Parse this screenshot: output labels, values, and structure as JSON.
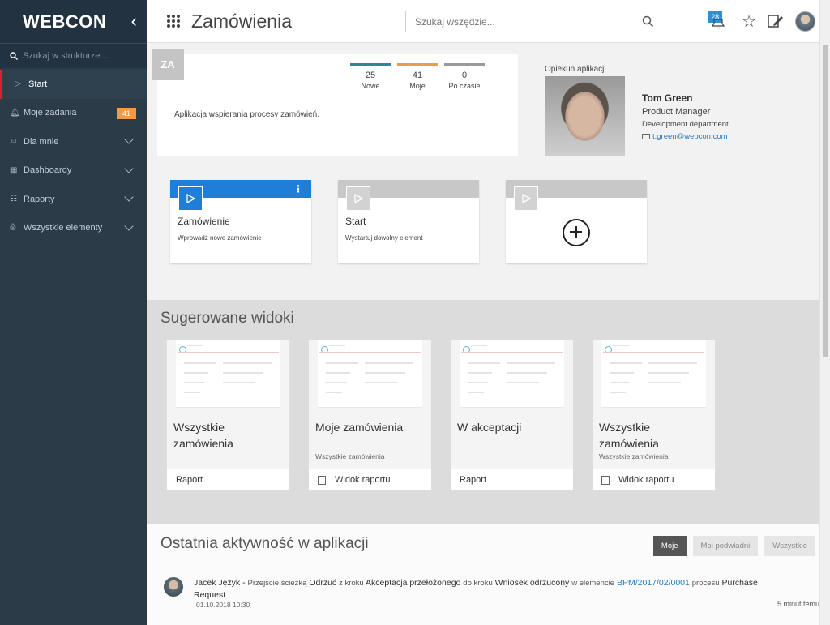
{
  "sidebar": {
    "logo": "WEBCON",
    "search_placeholder": "Szukaj w strukturze ...",
    "items": [
      {
        "label": "Start"
      },
      {
        "label": "Moje zadania",
        "badge": "41"
      },
      {
        "label": "Dla mnie"
      },
      {
        "label": "Dashboardy"
      },
      {
        "label": "Raporty"
      },
      {
        "label": "Wszystkie elementy"
      }
    ]
  },
  "header": {
    "title": "Zamówienia",
    "search_placeholder": "Szukaj wszędzie...",
    "notifications": "28"
  },
  "app_info": {
    "initials": "ZA",
    "counters": [
      {
        "value": "25",
        "label": "Nowe",
        "color": "#2c8a96"
      },
      {
        "value": "41",
        "label": "Moje",
        "color": "#f39b40"
      },
      {
        "value": "0",
        "label": "Po czasie",
        "color": "#9a9a9a"
      }
    ],
    "description": "Aplikacja wspierania procesy zamówień."
  },
  "guardian": {
    "label": "Opiekun aplikacji",
    "name": "Tom Green",
    "role": "Product Manager",
    "department": "Development department",
    "email": "t.green@webcon.com"
  },
  "tiles": [
    {
      "title": "Zamówienie",
      "subtitle": "Wprowadź nowe zamówienie"
    },
    {
      "title": "Start",
      "subtitle": "Wystartuj dowolny element"
    },
    {
      "title": "",
      "subtitle": ""
    }
  ],
  "suggested": {
    "title": "Sugerowane widoki",
    "views": [
      {
        "title": "Wszystkie zamówienia",
        "subtitle": "",
        "footer": "Raport"
      },
      {
        "title": "Moje zamówienia",
        "subtitle": "Wszystkie zamówienia",
        "footer": "Widok raportu"
      },
      {
        "title": "W akceptacji",
        "subtitle": "",
        "footer": "Raport"
      },
      {
        "title": "Wszystkie zamówienia",
        "subtitle": "Wszystkie zamówienia",
        "footer": "Widok raportu"
      }
    ]
  },
  "activity": {
    "title": "Ostatnia aktywność w aplikacji",
    "filters": [
      "Moje",
      "Moi podwładni",
      "Wszystkie"
    ],
    "entry": {
      "user": "Jacek Jężyk -",
      "t1": "Przejście ścieżką",
      "path": "Odrzuć",
      "t2": "z kroku",
      "from": "Akceptacja przełożonego",
      "t3": "do kroku",
      "to": "Wniosek odrzucony",
      "t4": "w elemencie",
      "element": "BPM/2017/02/0001",
      "t5": "procesu",
      "process": "Purchase Request .",
      "date": "01.10.2018 10:30",
      "ago": "5 minut temu"
    }
  }
}
